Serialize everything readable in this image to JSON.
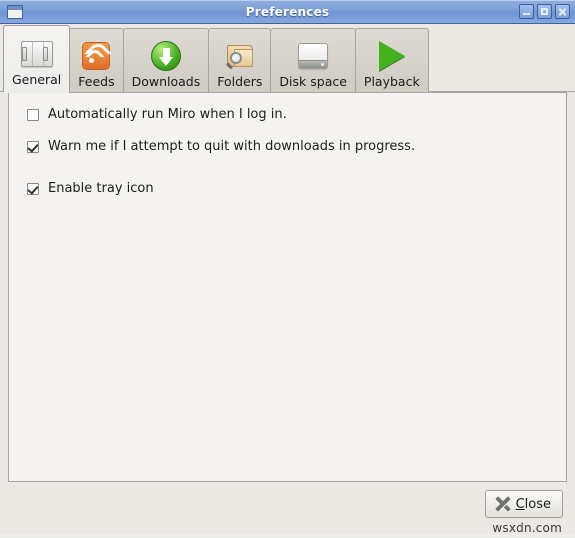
{
  "window": {
    "title": "Preferences",
    "icon": "window-icon",
    "controls": [
      {
        "name": "minimize",
        "glyph": "minimize-icon"
      },
      {
        "name": "maximize",
        "glyph": "maximize-icon"
      },
      {
        "name": "close",
        "glyph": "close-icon"
      }
    ]
  },
  "tabs": [
    {
      "label": "General",
      "icon": "switches-panel-icon",
      "selected": true
    },
    {
      "label": "Feeds",
      "icon": "rss-feed-icon",
      "selected": false
    },
    {
      "label": "Downloads",
      "icon": "green-down-arrow-icon",
      "selected": false
    },
    {
      "label": "Folders",
      "icon": "folder-search-icon",
      "selected": false
    },
    {
      "label": "Disk space",
      "icon": "hard-drive-icon",
      "selected": false
    },
    {
      "label": "Playback",
      "icon": "green-play-icon",
      "selected": false
    }
  ],
  "general": {
    "options": [
      {
        "label": "Automatically run Miro when I log in.",
        "checked": false
      },
      {
        "label": "Warn me if I attempt to quit with downloads in progress.",
        "checked": true
      },
      {
        "label": "Enable tray icon",
        "checked": true
      }
    ]
  },
  "footer": {
    "close_button": {
      "label": "Close",
      "accelerator": "C",
      "icon": "x-mark-icon"
    }
  },
  "watermark": "wsxdn.com",
  "colors": {
    "titlebar_start": "#90aede",
    "titlebar_end": "#87a8df",
    "window_bg": "#ece9e4",
    "panel_bg": "#f4f3f1",
    "border": "#a8a49e",
    "rss_orange": "#e0702a",
    "download_green": "#45a821",
    "play_green": "#46b01f",
    "folder_tan": "#dcbe83"
  }
}
